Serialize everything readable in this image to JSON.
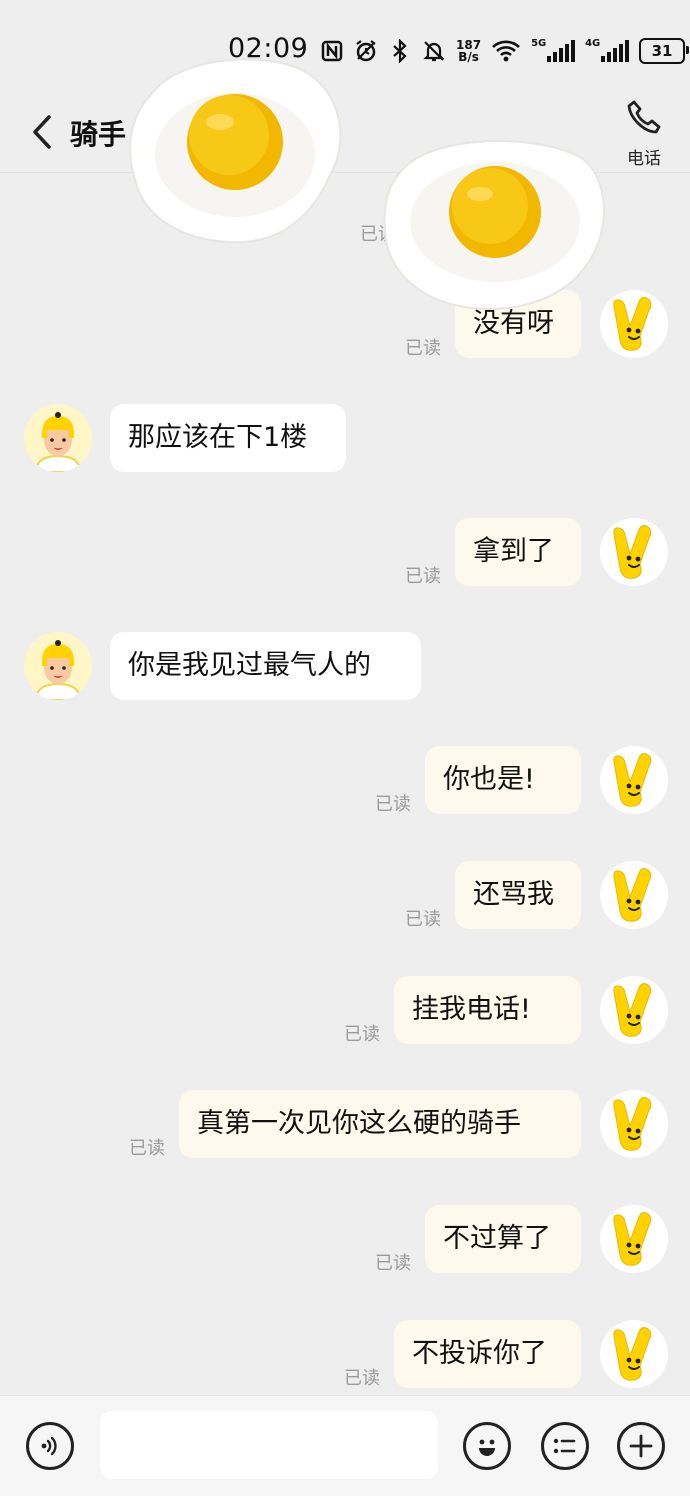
{
  "status_bar": {
    "time": "02:09",
    "net_speed_top": "187",
    "net_speed_bottom": "B/s",
    "sim1_type": "5G",
    "sim2_type": "4G",
    "battery": "31",
    "icons": [
      "nfc-icon",
      "alarm-icon",
      "bluetooth-icon",
      "mute-icon",
      "wifi-icon",
      "signal-icon",
      "battery-icon"
    ]
  },
  "header": {
    "title": "骑手",
    "call_label": "电话",
    "back_icon": "chevron-left-icon",
    "call_icon": "phone-icon"
  },
  "messages": [
    {
      "side": "out",
      "text": "",
      "read": "已读"
    },
    {
      "side": "out",
      "text": "没有呀",
      "read": "已读"
    },
    {
      "side": "in",
      "text": "那应该在下1楼"
    },
    {
      "side": "out",
      "text": "拿到了",
      "read": "已读"
    },
    {
      "side": "in",
      "text": "你是我见过最气人的"
    },
    {
      "side": "out",
      "text": "你也是!",
      "read": "已读"
    },
    {
      "side": "out",
      "text": "还骂我",
      "read": "已读"
    },
    {
      "side": "out",
      "text": "挂我电话!",
      "read": "已读"
    },
    {
      "side": "out",
      "text": "真第一次见你这么硬的骑手",
      "read": "已读"
    },
    {
      "side": "out",
      "text": "不过算了",
      "read": "已读"
    },
    {
      "side": "out",
      "text": "不投诉你了",
      "read": "已读"
    }
  ],
  "input_bar": {
    "placeholder": "",
    "icons": [
      "voice-icon",
      "emoji-icon",
      "quick-reply-icon",
      "plus-icon"
    ]
  },
  "colors": {
    "background": "#eeeeee",
    "incoming_bubble": "#ffffff",
    "outgoing_bubble": "#fdf9ec",
    "read_text": "#9a9a9a",
    "mascot_yellow": "#ffd200"
  }
}
